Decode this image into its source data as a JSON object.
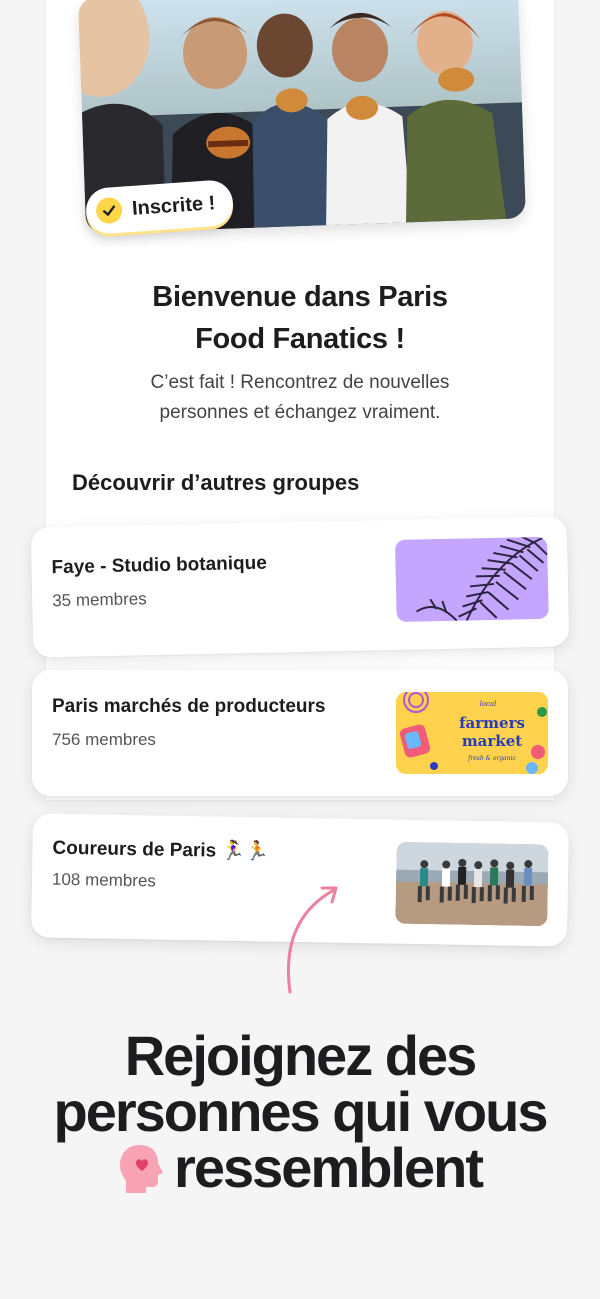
{
  "badge": {
    "label": "Inscrite !",
    "icon": "check-icon"
  },
  "welcome": {
    "title_line1": "Bienvenue dans Paris",
    "title_line2": "Food Fanatics !",
    "subtitle_line1": "C’est fait ! Rencontrez de nouvelles",
    "subtitle_line2": "personnes et échangez vraiment."
  },
  "discover": {
    "heading": "Découvrir d’autres groupes",
    "groups": [
      {
        "name": "Faye - Studio botanique",
        "members": "35 membres"
      },
      {
        "name": "Paris marchés de producteurs",
        "members": "756 membres",
        "thumb_text": {
          "small_top": "local",
          "main1": "farmers",
          "main2": "market",
          "small_bottom": "fresh & organic"
        }
      },
      {
        "name": "Coureurs de Paris 🏃‍♀️🏃",
        "members": "108 membres"
      }
    ]
  },
  "headline": {
    "line1": "Rejoignez des",
    "line2": "personnes qui vous",
    "line3": "ressemblent",
    "icon": "head-heart-icon"
  },
  "colors": {
    "accent_yellow": "#ffd54a",
    "lavender": "#c4a6ff",
    "pink_arrow": "#ef7ea0",
    "market_yellow": "#ffd24d",
    "market_blue": "#2a3cb8"
  }
}
